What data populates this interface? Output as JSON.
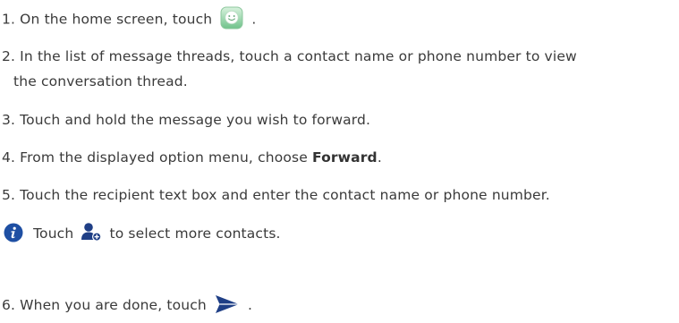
{
  "steps": [
    {
      "num": "1.",
      "text_before": "On the home screen, touch",
      "icon": "messaging-app-icon",
      "text_after": "."
    },
    {
      "num": "2.",
      "text_line1": "In the list of message threads, touch a contact name or phone number to view",
      "text_line2": "the conversation thread."
    },
    {
      "num": "3.",
      "text": "Touch and hold the message you wish to forward."
    },
    {
      "num": "4.",
      "text_before": "From the displayed option menu, choose",
      "bold": "Forward",
      "text_after": "."
    },
    {
      "num": "5.",
      "text": "Touch the recipient text box and enter the contact name or phone number."
    },
    {
      "num": "6.",
      "text_before": "When you are done, touch",
      "icon": "send-icon",
      "text_after": "."
    }
  ],
  "note": {
    "icon": "info-icon",
    "text_before": "Touch",
    "icon_inline": "add-contact-icon",
    "text_after": "to select more contacts."
  },
  "colors": {
    "text": "#3a3a3a",
    "info_icon": "#1e4fa3",
    "messaging_icon": "#8fd3a0",
    "send_icon": "#1f3f86",
    "contact_icon": "#1f3f86"
  }
}
